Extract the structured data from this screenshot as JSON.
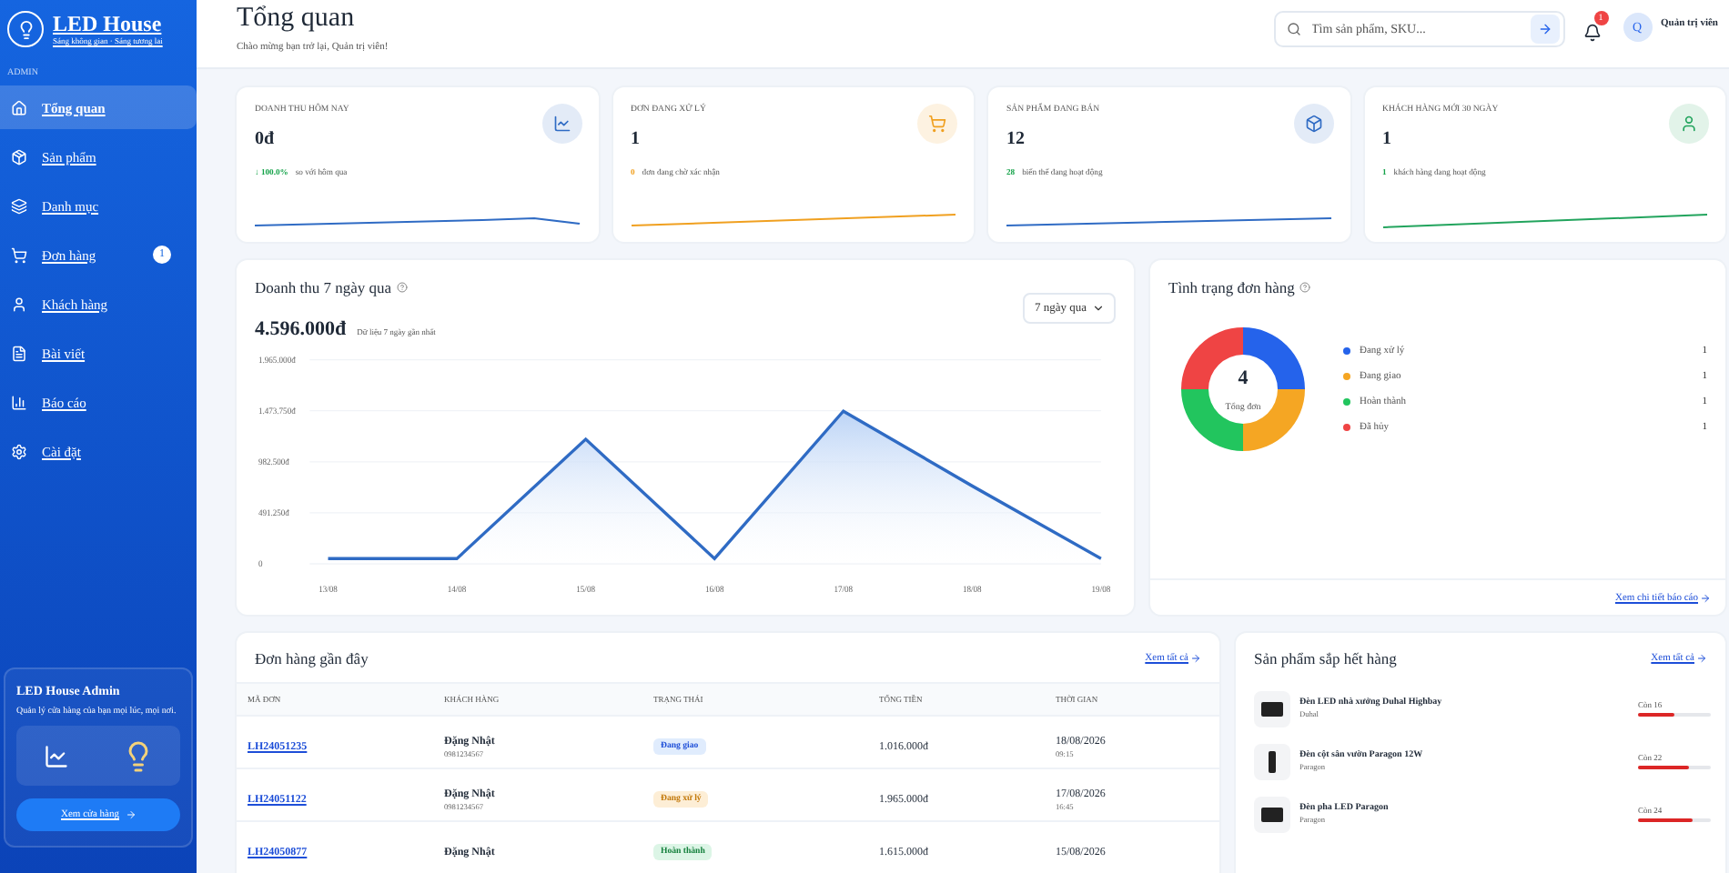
{
  "sidebar": {
    "brand": "LED House",
    "tagline": "Sáng không gian · Sáng tương lai",
    "section": "ADMIN",
    "items": [
      {
        "label": "Tổng quan",
        "kind": "home",
        "selected": true
      },
      {
        "label": "Sản phẩm",
        "kind": "box",
        "selected": false
      },
      {
        "label": "Danh mục",
        "kind": "layers",
        "selected": false
      },
      {
        "label": "Đơn hàng",
        "kind": "cart",
        "selected": false,
        "badge": "1"
      },
      {
        "label": "Khách hàng",
        "kind": "user",
        "selected": false
      },
      {
        "label": "Bài viết",
        "kind": "file",
        "selected": false
      },
      {
        "label": "Báo cáo",
        "kind": "chart",
        "selected": false
      },
      {
        "label": "Cài đặt",
        "kind": "gear",
        "selected": false
      }
    ],
    "promo": {
      "title": "LED House Admin",
      "text": "Quản lý cửa hàng của bạn mọi lúc, mọi nơi.",
      "button": "Xem cửa hàng"
    }
  },
  "header": {
    "title": "Tổng quan",
    "subtitle": "Chào mừng bạn trở lại, Quản trị viên!",
    "search": {
      "placeholder": "Tìm sản phẩm, SKU..."
    },
    "notifications": "1",
    "avatar": "Q",
    "user": "Quản trị viên"
  },
  "stats": [
    {
      "label": "DOANH THU HÔM NAY",
      "value": "0đ",
      "kind": "revenue",
      "color": "#2f6bc4",
      "delta": "↓ 100.0%",
      "note": "so với hôm qua"
    },
    {
      "label": "ĐƠN ĐANG XỬ LÝ",
      "value": "1",
      "kind": "orders",
      "color": "#f0a020",
      "delta": "0",
      "note": "đơn đang chờ xác nhận"
    },
    {
      "label": "SẢN PHẨM ĐANG BÁN",
      "value": "12",
      "kind": "products",
      "color": "#2f6bc4",
      "delta": "28",
      "note": "biến thể đang hoạt động"
    },
    {
      "label": "KHÁCH HÀNG MỚI 30 NGÀY",
      "value": "1",
      "kind": "customers",
      "color": "#22a45d",
      "delta": "1",
      "note": "khách hàng đang hoạt động"
    }
  ],
  "revenue": {
    "title": "Doanh thu 7 ngày qua",
    "total": "4.596.000đ",
    "total_note": "Dữ liệu 7 ngày gần nhất",
    "range": "7 ngày qua",
    "chart_data": {
      "type": "area",
      "categories": [
        "13/08",
        "14/08",
        "15/08",
        "16/08",
        "17/08",
        "18/08",
        "19/08"
      ],
      "series": [
        {
          "color": "#2f6bc4",
          "values": [
            50000,
            50000,
            1200000,
            50000,
            1470000,
            750000,
            50000
          ]
        }
      ],
      "ylim": [
        0,
        1965000
      ],
      "grid": true,
      "yticks": [
        {
          "value": 0,
          "label": "0"
        },
        {
          "value": 491250,
          "label": "491.250đ"
        },
        {
          "value": 982500,
          "label": "982.500đ"
        },
        {
          "value": 1473750,
          "label": "1.473.750đ"
        },
        {
          "value": 1965000,
          "label": "1.965.000đ"
        }
      ]
    }
  },
  "order_status": {
    "title": "Tình trạng đơn hàng",
    "total": "4",
    "total_label": "Tổng đơn",
    "legend": [
      {
        "label": "Đang xử lý",
        "count": "1",
        "color": "#2563eb"
      },
      {
        "label": "Đang giao",
        "count": "1",
        "color": "#f5a623"
      },
      {
        "label": "Hoàn thành",
        "count": "1",
        "color": "#22c55e"
      },
      {
        "label": "Đã hủy",
        "count": "1",
        "color": "#ef4444"
      }
    ],
    "link": "Xem chi tiết báo cáo"
  },
  "recent_orders": {
    "title": "Đơn hàng gần đây",
    "link": "Xem tất cả",
    "columns": [
      "MÃ ĐƠN",
      "KHÁCH HÀNG",
      "TRẠNG THÁI",
      "TỔNG TIỀN",
      "THỜI GIAN"
    ],
    "rows": [
      {
        "code": "LH24051235",
        "customer": "Đặng Nhật",
        "phone": "0981234567",
        "status": "Đang giao",
        "kind": "shipping",
        "total": "1.016.000đ",
        "date": "18/08/2026",
        "time": "09:15"
      },
      {
        "code": "LH24051122",
        "customer": "Đặng Nhật",
        "phone": "0981234567",
        "status": "Đang xử lý",
        "kind": "processing",
        "total": "1.965.000đ",
        "date": "17/08/2026",
        "time": "16:45"
      },
      {
        "code": "LH24050877",
        "customer": "Đặng Nhật",
        "status": "Hoàn thành",
        "kind": "done",
        "total": "1.615.000đ",
        "date": "15/08/2026"
      }
    ]
  },
  "low_stock": {
    "title": "Sản phẩm sắp hết hàng",
    "link": "Xem tất cả",
    "items": [
      {
        "name": "Đèn LED nhà xưởng Duhal Highbay",
        "brand": "Duhal",
        "stock": "Còn 16",
        "level": 0.5,
        "kind": "panel"
      },
      {
        "name": "Đèn cột sân vườn Paragon 12W",
        "brand": "Paragon",
        "stock": "Còn 22",
        "level": 0.7,
        "kind": "pole"
      },
      {
        "name": "Đèn pha LED Paragon",
        "brand": "Paragon",
        "stock": "Còn 24",
        "level": 0.75,
        "kind": "panel"
      }
    ]
  }
}
